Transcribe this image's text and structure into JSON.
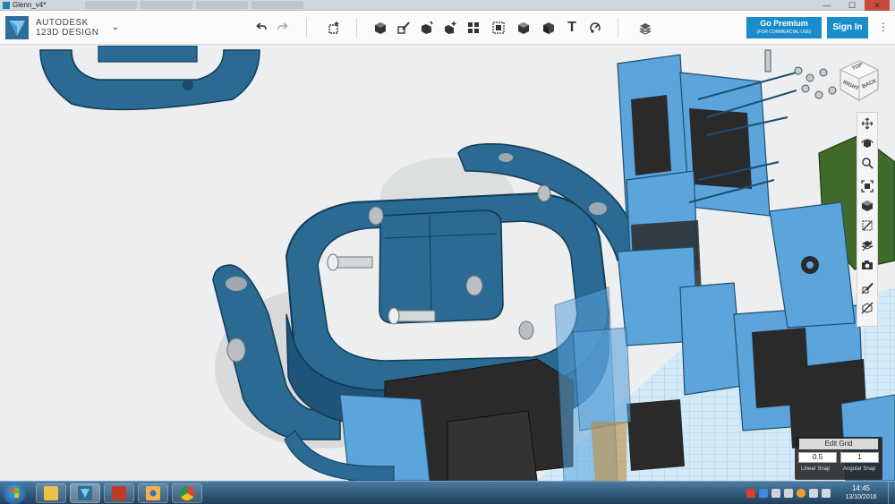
{
  "window": {
    "title": "Glenn_v4*",
    "controls": {
      "minimize": "—",
      "maximize": "☐",
      "close": "✕"
    }
  },
  "brand": {
    "line1": "AUTODESK",
    "line2": "123D",
    "line2_suffix": "DESIGN"
  },
  "toolbar": {
    "tools": [
      {
        "name": "undo-icon"
      },
      {
        "name": "redo-icon"
      },
      {
        "name": "transform-icon"
      },
      {
        "name": "primitives-icon"
      },
      {
        "name": "sketch-icon"
      },
      {
        "name": "construct-icon"
      },
      {
        "name": "modify-icon"
      },
      {
        "name": "pattern-icon"
      },
      {
        "name": "group-icon"
      },
      {
        "name": "combine-icon"
      },
      {
        "name": "measure-icon"
      },
      {
        "name": "text-icon"
      },
      {
        "name": "snap-icon"
      },
      {
        "name": "materials-icon"
      }
    ],
    "text_tool_glyph": "T"
  },
  "premium": {
    "label": "Go Premium",
    "sublabel": "(FOR COMMERCIAL USE)"
  },
  "sign_in": {
    "label": "Sign In"
  },
  "view_cube": {
    "faces": [
      "RIGHT",
      "BACK"
    ]
  },
  "nav_tools": [
    "pan-icon",
    "orbit-icon",
    "zoom-icon",
    "fit-icon",
    "view-style-icon",
    "visibility-icon",
    "materials-visibility-icon",
    "screenshot-icon",
    "hide-sketch-icon",
    "hide-mesh-icon"
  ],
  "edit_grid": {
    "button_label": "Edit Grid",
    "snap_value": "0.5",
    "angle_value": "1",
    "snap_label": "Linear Snap",
    "angle_label": "Angular Snap"
  },
  "taskbar": {
    "apps": [
      "explorer",
      "123d-design",
      "reaper",
      "browser-eye",
      "chrome"
    ],
    "clock_time": "14:45",
    "clock_date": "13/10/2016"
  },
  "colors": {
    "accent": "#1a8cc9",
    "model_blue": "#2a6a93",
    "model_light_blue": "#5ba4dc",
    "servo_black": "#2a2a2a",
    "green_part": "#3f6b2a"
  }
}
